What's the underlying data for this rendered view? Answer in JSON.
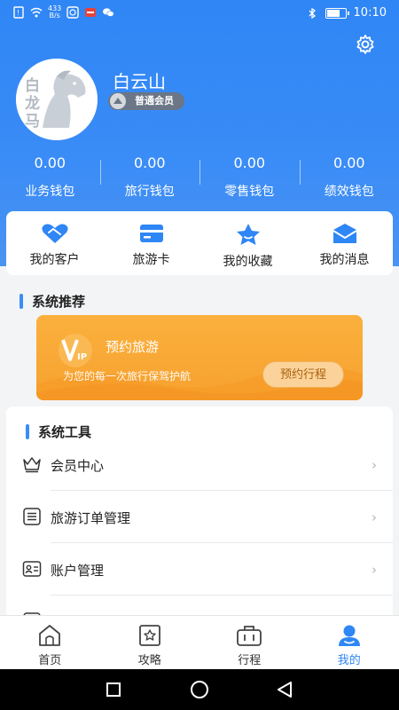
{
  "status_bar": {
    "speed_value": "433",
    "speed_unit": "B/s",
    "time": "10:10",
    "battery_level": 0.7
  },
  "profile": {
    "avatar_text": "白龙马",
    "username": "白云山",
    "member_level": "普通会员"
  },
  "wallets": [
    {
      "value": "0.00",
      "label": "业务钱包"
    },
    {
      "value": "0.00",
      "label": "旅行钱包"
    },
    {
      "value": "0.00",
      "label": "零售钱包"
    },
    {
      "value": "0.00",
      "label": "绩效钱包"
    }
  ],
  "quick_links": [
    {
      "label": "我的客户",
      "icon": "handshake-icon"
    },
    {
      "label": "旅游卡",
      "icon": "card-icon"
    },
    {
      "label": "我的收藏",
      "icon": "star-icon"
    },
    {
      "label": "我的消息",
      "icon": "mail-icon"
    }
  ],
  "recommend": {
    "title": "系统推荐",
    "banner_title": "预约旅游",
    "banner_subtitle": "为您的每一次旅行保驾护航",
    "banner_button": "预约行程"
  },
  "tools": {
    "title": "系统工具",
    "items": [
      {
        "label": "会员中心",
        "icon": "crown-icon"
      },
      {
        "label": "旅游订单管理",
        "icon": "list-icon"
      },
      {
        "label": "账户管理",
        "icon": "id-card-icon"
      }
    ]
  },
  "tabbar": [
    {
      "label": "首页",
      "icon": "home-icon"
    },
    {
      "label": "攻略",
      "icon": "guide-icon"
    },
    {
      "label": "行程",
      "icon": "luggage-icon"
    },
    {
      "label": "我的",
      "icon": "profile-icon",
      "active": true
    }
  ],
  "colors": {
    "primary": "#2f86f5",
    "banner": "#f6a12f",
    "background": "#f3f4f6"
  }
}
